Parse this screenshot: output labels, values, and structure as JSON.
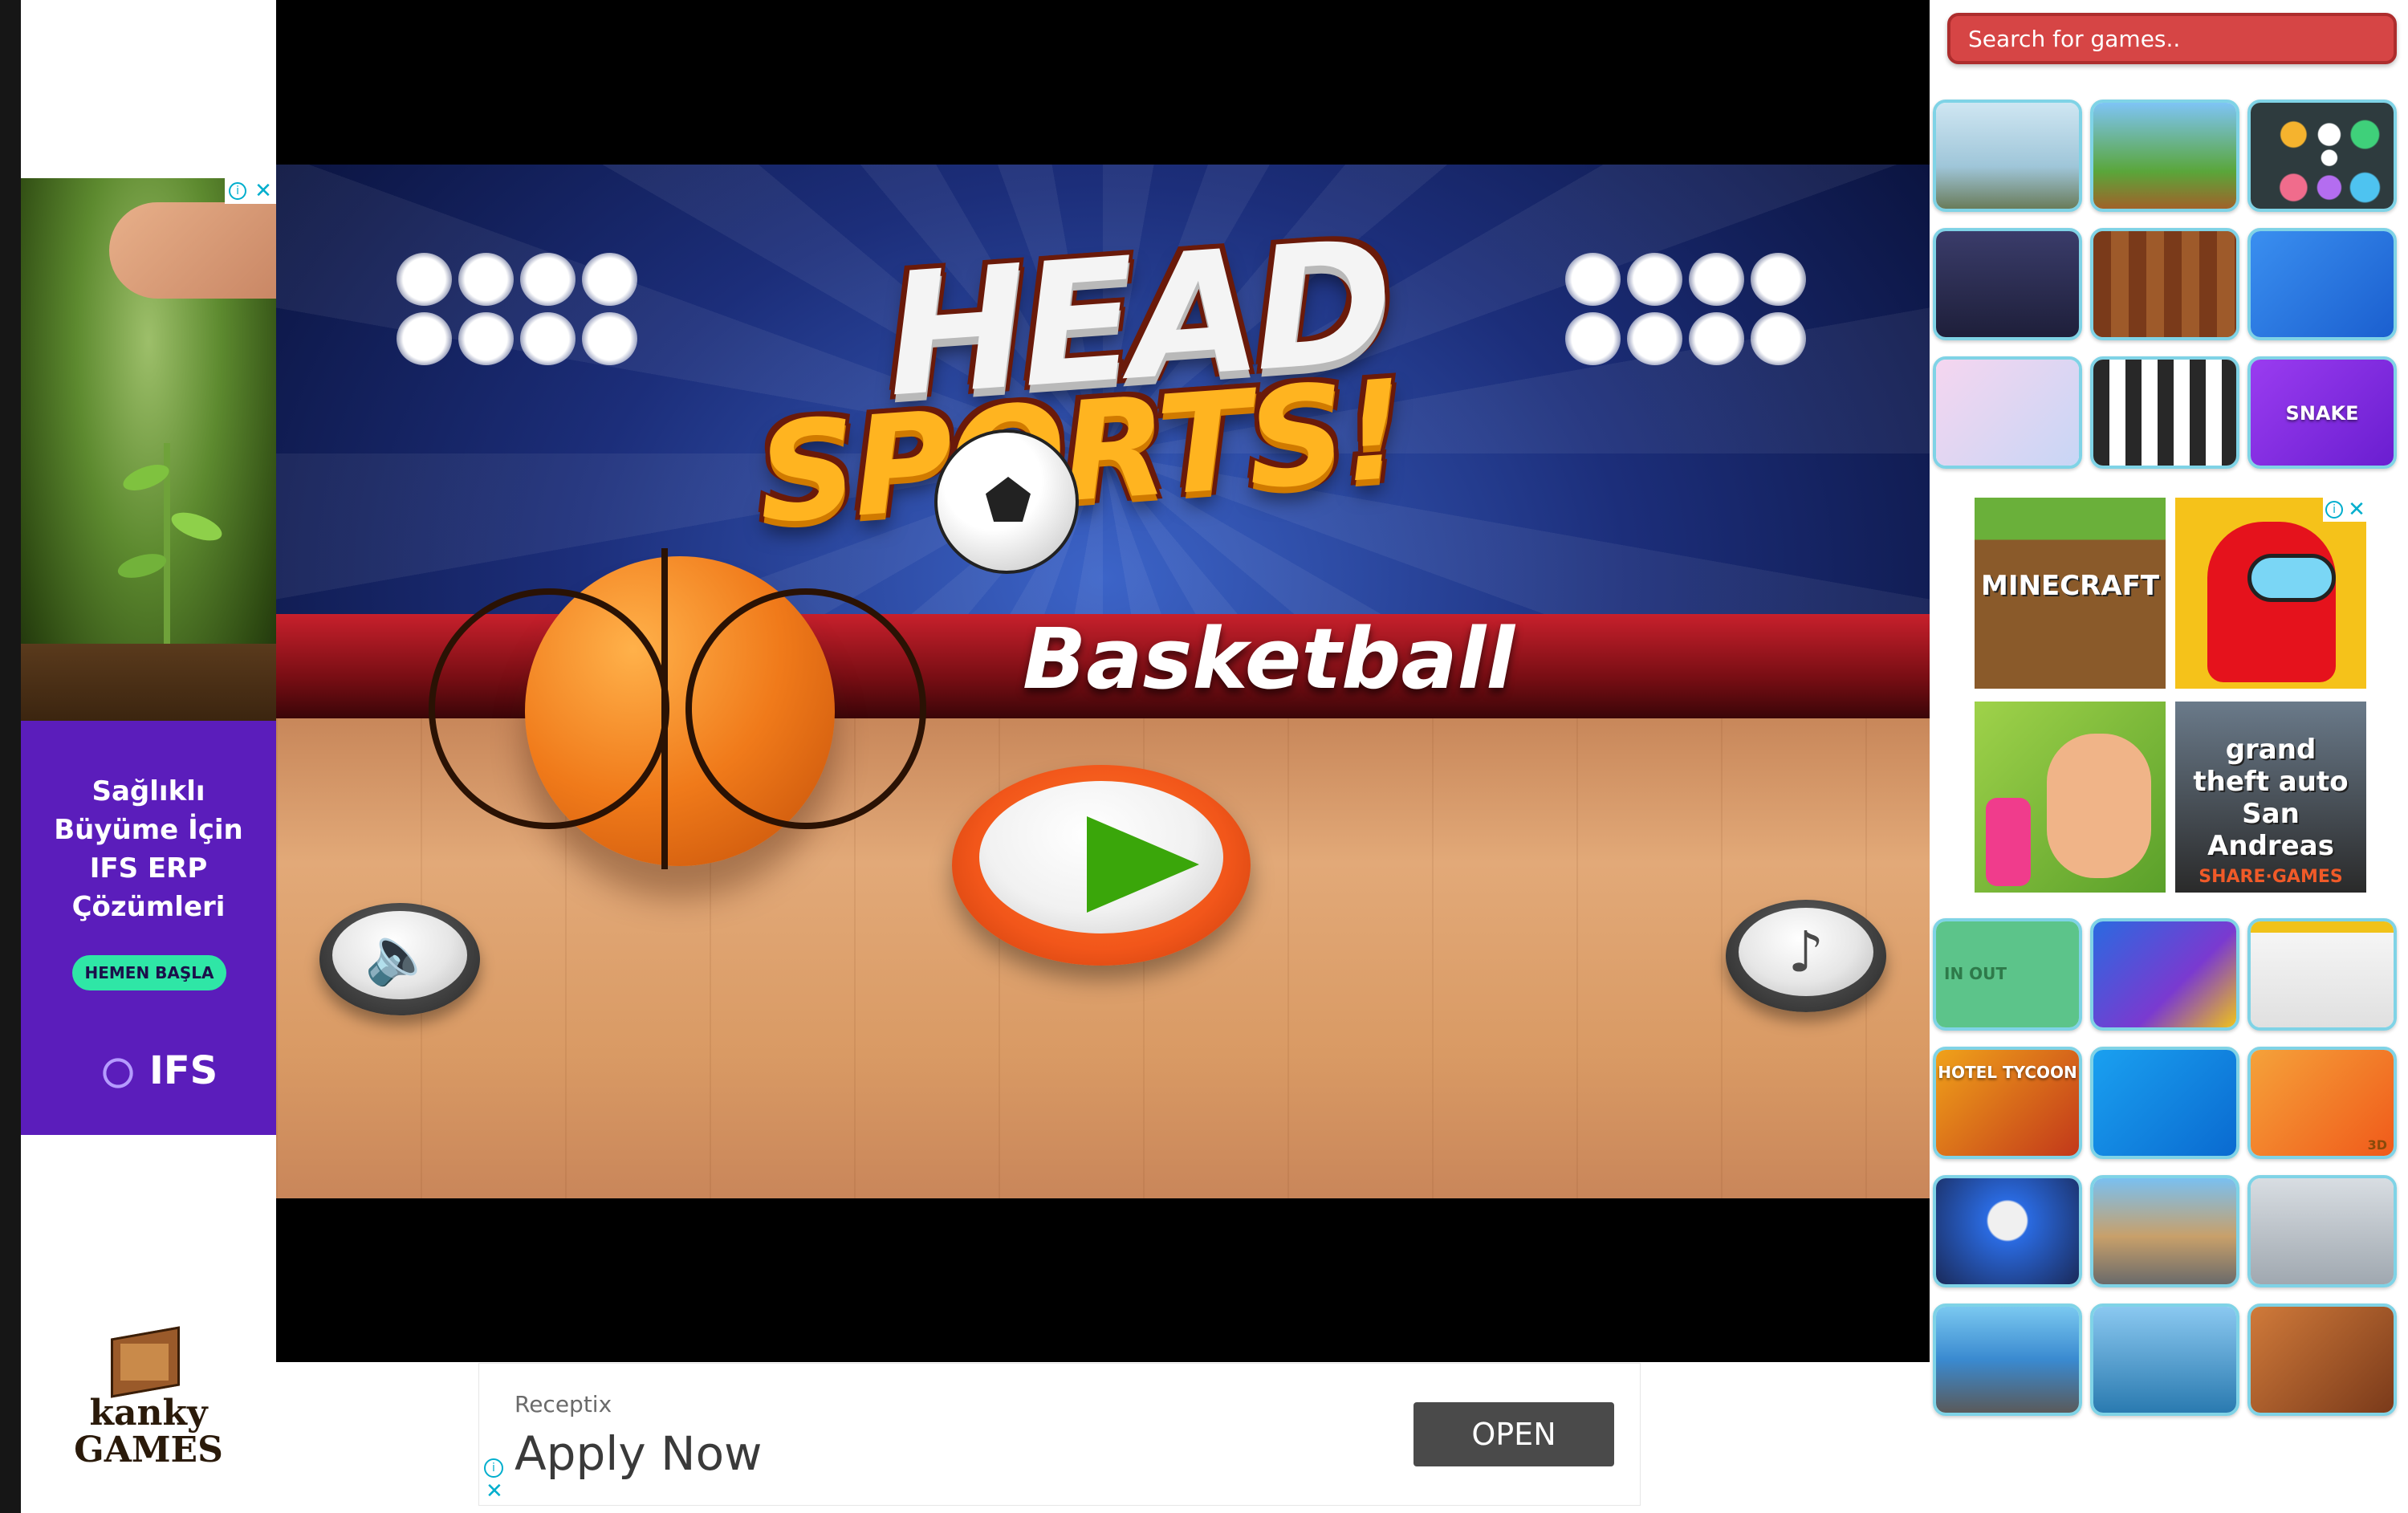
{
  "left_ad": {
    "text": "Sağlıklı\nBüyüme İçin\nIFS ERP\nÇözümleri",
    "cta": "HEMEN BAŞLA",
    "brand": "IFS"
  },
  "site_logo": {
    "text": "kanky\nGAMES"
  },
  "game": {
    "title_line1": "HEAD",
    "title_line2": "SPORTS!",
    "subtitle": "Basketball",
    "play_icon": "play-icon",
    "sound_icon": "speaker-icon",
    "music_icon": "music-note-icon",
    "sound_glyph": "🔈",
    "music_glyph": "♪"
  },
  "bottom_ad": {
    "advertiser": "Receptix",
    "headline": "Apply Now",
    "cta": "OPEN"
  },
  "sidebar": {
    "search_placeholder": "Search for games..",
    "mid_ad": {
      "items": [
        {
          "label": "MINECRAFT"
        },
        {
          "label": ""
        },
        {
          "label": ""
        },
        {
          "label": "grand theft auto San Andreas"
        },
        {
          "label": "SHARE·GAMES"
        }
      ]
    },
    "tile_labels": {
      "snake": "SNAKE",
      "hotel": "HOTEL TYCOON",
      "in_out": "IN OUT",
      "threed": "3D"
    }
  },
  "colors": {
    "search_bg": "#d64545",
    "tile_border": "#7fd3e6",
    "ad_purple": "#5b1dbb",
    "ad_cta": "#2fe6a6",
    "play_green": "#3aa60a",
    "play_orange": "#f2561a"
  }
}
